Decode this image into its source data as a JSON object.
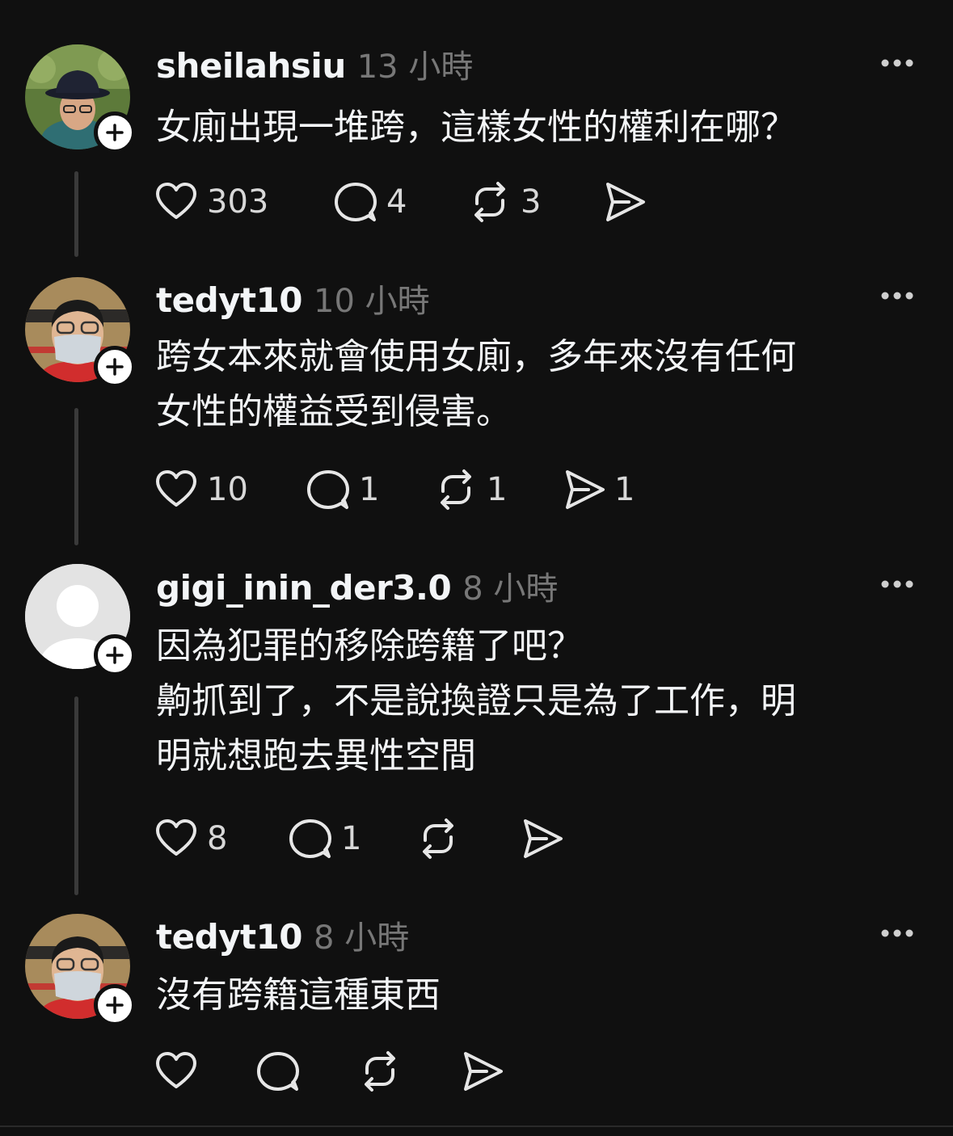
{
  "posts": [
    {
      "username": "sheilahsiu",
      "time": "13 小時",
      "text": "女廁出現一堆跨，這樣女性的權利在哪？",
      "likes": "303",
      "replies": "4",
      "reposts": "3",
      "shares": ""
    },
    {
      "username": "tedyt10",
      "time": "10 小時",
      "text": "跨女本來就會使用女廁，多年來沒有任何\n女性的權益受到侵害。",
      "likes": "10",
      "replies": "1",
      "reposts": "1",
      "shares": "1"
    },
    {
      "username": "gigi_inin_der3.0",
      "time": "8 小時",
      "text": "因為犯罪的移除跨籍了吧？\n齁抓到了，不是說換證只是為了工作，明\n明就想跑去異性空間",
      "likes": "8",
      "replies": "1",
      "reposts": "",
      "shares": ""
    },
    {
      "username": "tedyt10",
      "time": "8 小時",
      "text": "沒有跨籍這種東西",
      "likes": "",
      "replies": "",
      "reposts": "",
      "shares": ""
    }
  ],
  "icons": {
    "like": "heart-icon",
    "reply": "comment-icon",
    "repost": "repost-icon",
    "share": "send-icon",
    "more": "more-icon",
    "follow": "plus-icon"
  },
  "colors": {
    "background": "#101010",
    "text": "#f3f5f7",
    "muted": "#777777"
  }
}
